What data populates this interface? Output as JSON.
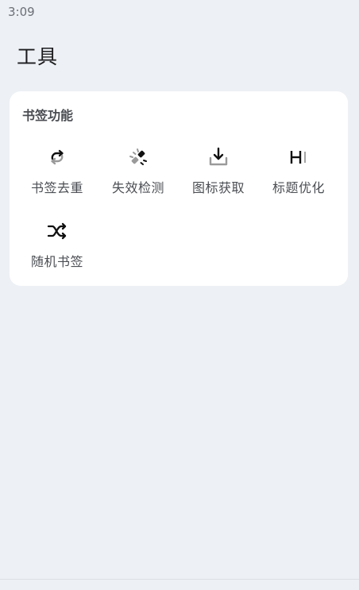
{
  "status_bar": {
    "time": "3:09"
  },
  "page": {
    "title": "工具"
  },
  "bookmark_section": {
    "title": "书签功能",
    "tools": [
      {
        "label": "书签去重",
        "icon": "repeat-icon"
      },
      {
        "label": "失效检测",
        "icon": "broken-link-icon"
      },
      {
        "label": "图标获取",
        "icon": "download-tray-icon"
      },
      {
        "label": "标题优化",
        "icon": "heading-icon"
      },
      {
        "label": "随机书签",
        "icon": "shuffle-icon"
      }
    ]
  }
}
